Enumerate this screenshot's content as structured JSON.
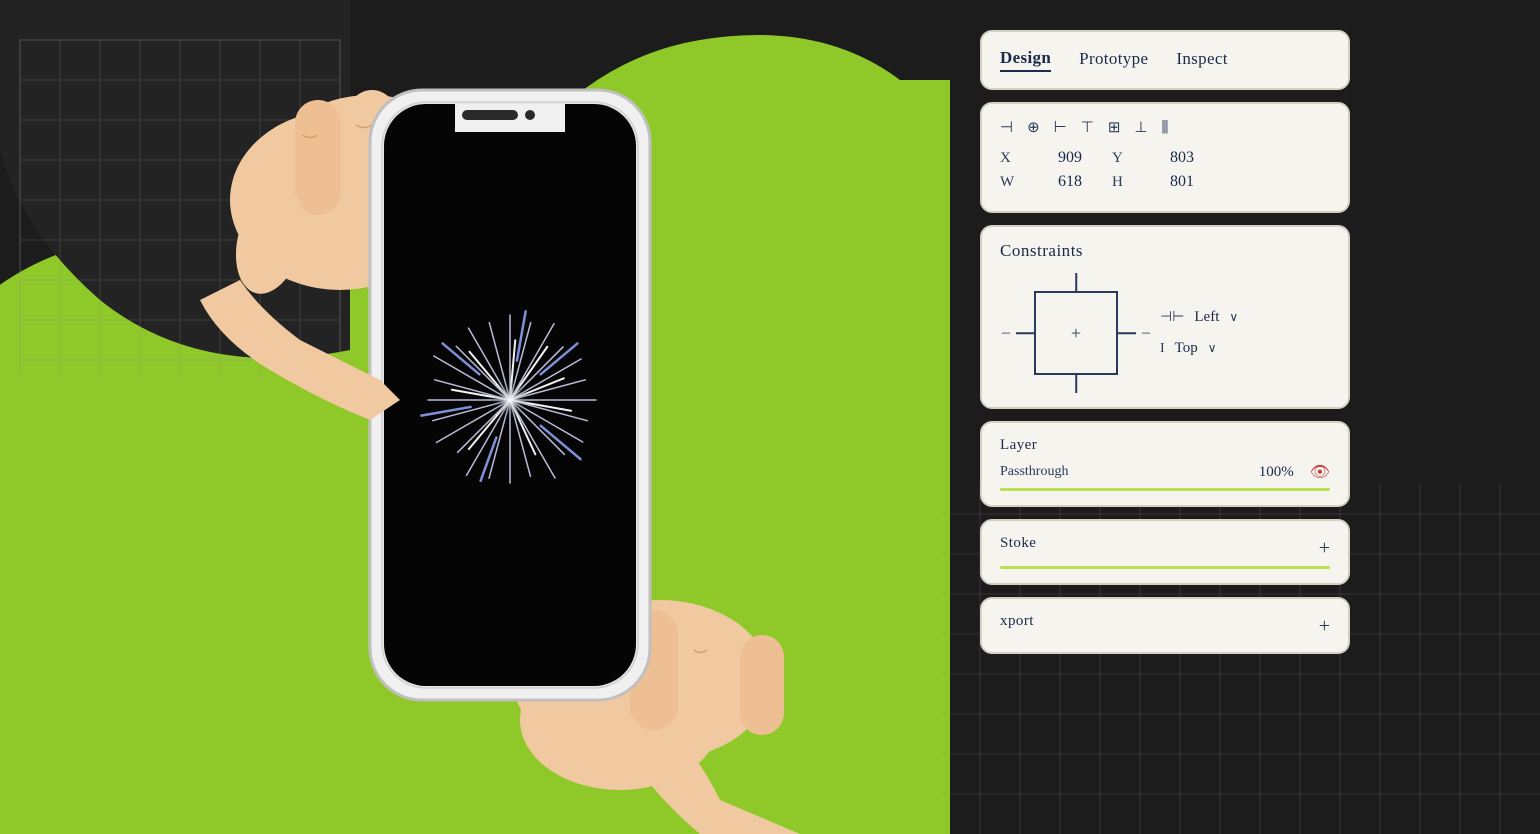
{
  "background": {
    "color_dark": "#1c1c1c",
    "color_green": "#8fc929",
    "color_dark_accent": "#161616"
  },
  "tabs": {
    "items": [
      {
        "label": "Design",
        "active": true
      },
      {
        "label": "Prototype",
        "active": false
      },
      {
        "label": "Inspect",
        "active": false
      }
    ]
  },
  "properties": {
    "x_label": "X",
    "x_value": "909",
    "y_label": "Y",
    "y_value": "803",
    "w_label": "W",
    "w_value": "618",
    "h_label": "H",
    "h_value": "801"
  },
  "constraints": {
    "title": "Constraints",
    "horizontal_label": "Left",
    "horizontal_arrow": "∨",
    "vertical_label": "Top",
    "vertical_arrow": "∨"
  },
  "layer": {
    "title": "Layer",
    "blend_label": "Passthrough",
    "opacity_value": "100%"
  },
  "stroke": {
    "title": "Stoke",
    "plus_label": "+"
  },
  "export": {
    "title": "xport",
    "plus_label": "+"
  },
  "phone": {
    "screen_bg": "#000000"
  }
}
